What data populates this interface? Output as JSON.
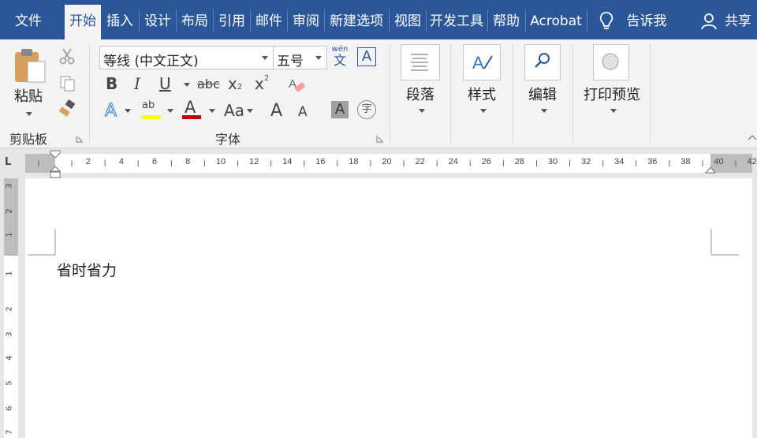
{
  "menu": {
    "tabs": [
      "文件",
      "开始",
      "插入",
      "设计",
      "布局",
      "引用",
      "邮件",
      "审阅",
      "新建选项",
      "视图",
      "开发工具",
      "帮助",
      "Acrobat"
    ],
    "active_tab": "开始",
    "tell_me": "告诉我",
    "share": "共享"
  },
  "ribbon": {
    "clipboard": {
      "paste_label": "粘贴",
      "group_label": "剪贴板"
    },
    "font": {
      "font_name": "等线 (中文正文)",
      "font_size": "五号",
      "phonetic_top": "wén",
      "phonetic_bottom": "文",
      "border_char": "A",
      "bold": "B",
      "italic": "I",
      "underline": "U",
      "strike": "abc",
      "subscript": "x",
      "sub_mark": "2",
      "superscript": "x",
      "sup_mark": "2",
      "text_effect": "A",
      "highlight": "ab",
      "font_color": "A",
      "case": "Aa",
      "grow": "A",
      "shrink": "A",
      "shade": "A",
      "enclose": "字",
      "group_label": "字体"
    },
    "paragraph_label": "段落",
    "styles_label": "样式",
    "editing_label": "编辑",
    "print_preview_label": "打印预览"
  },
  "ruler": {
    "corner": "L",
    "labels": [
      "2",
      "4",
      "6",
      "8",
      "10",
      "12",
      "14",
      "16",
      "18",
      "20",
      "22",
      "24",
      "26",
      "28",
      "30",
      "32",
      "34",
      "36",
      "38",
      "40",
      "42"
    ],
    "vertical_labels": [
      "3",
      "2",
      "1",
      "1",
      "2",
      "3",
      "4",
      "5",
      "6",
      "7"
    ]
  },
  "document": {
    "text": "省时省力"
  },
  "colors": {
    "accent": "#2b579a",
    "highlight": "#ffff00",
    "font_color": "#c00000"
  }
}
